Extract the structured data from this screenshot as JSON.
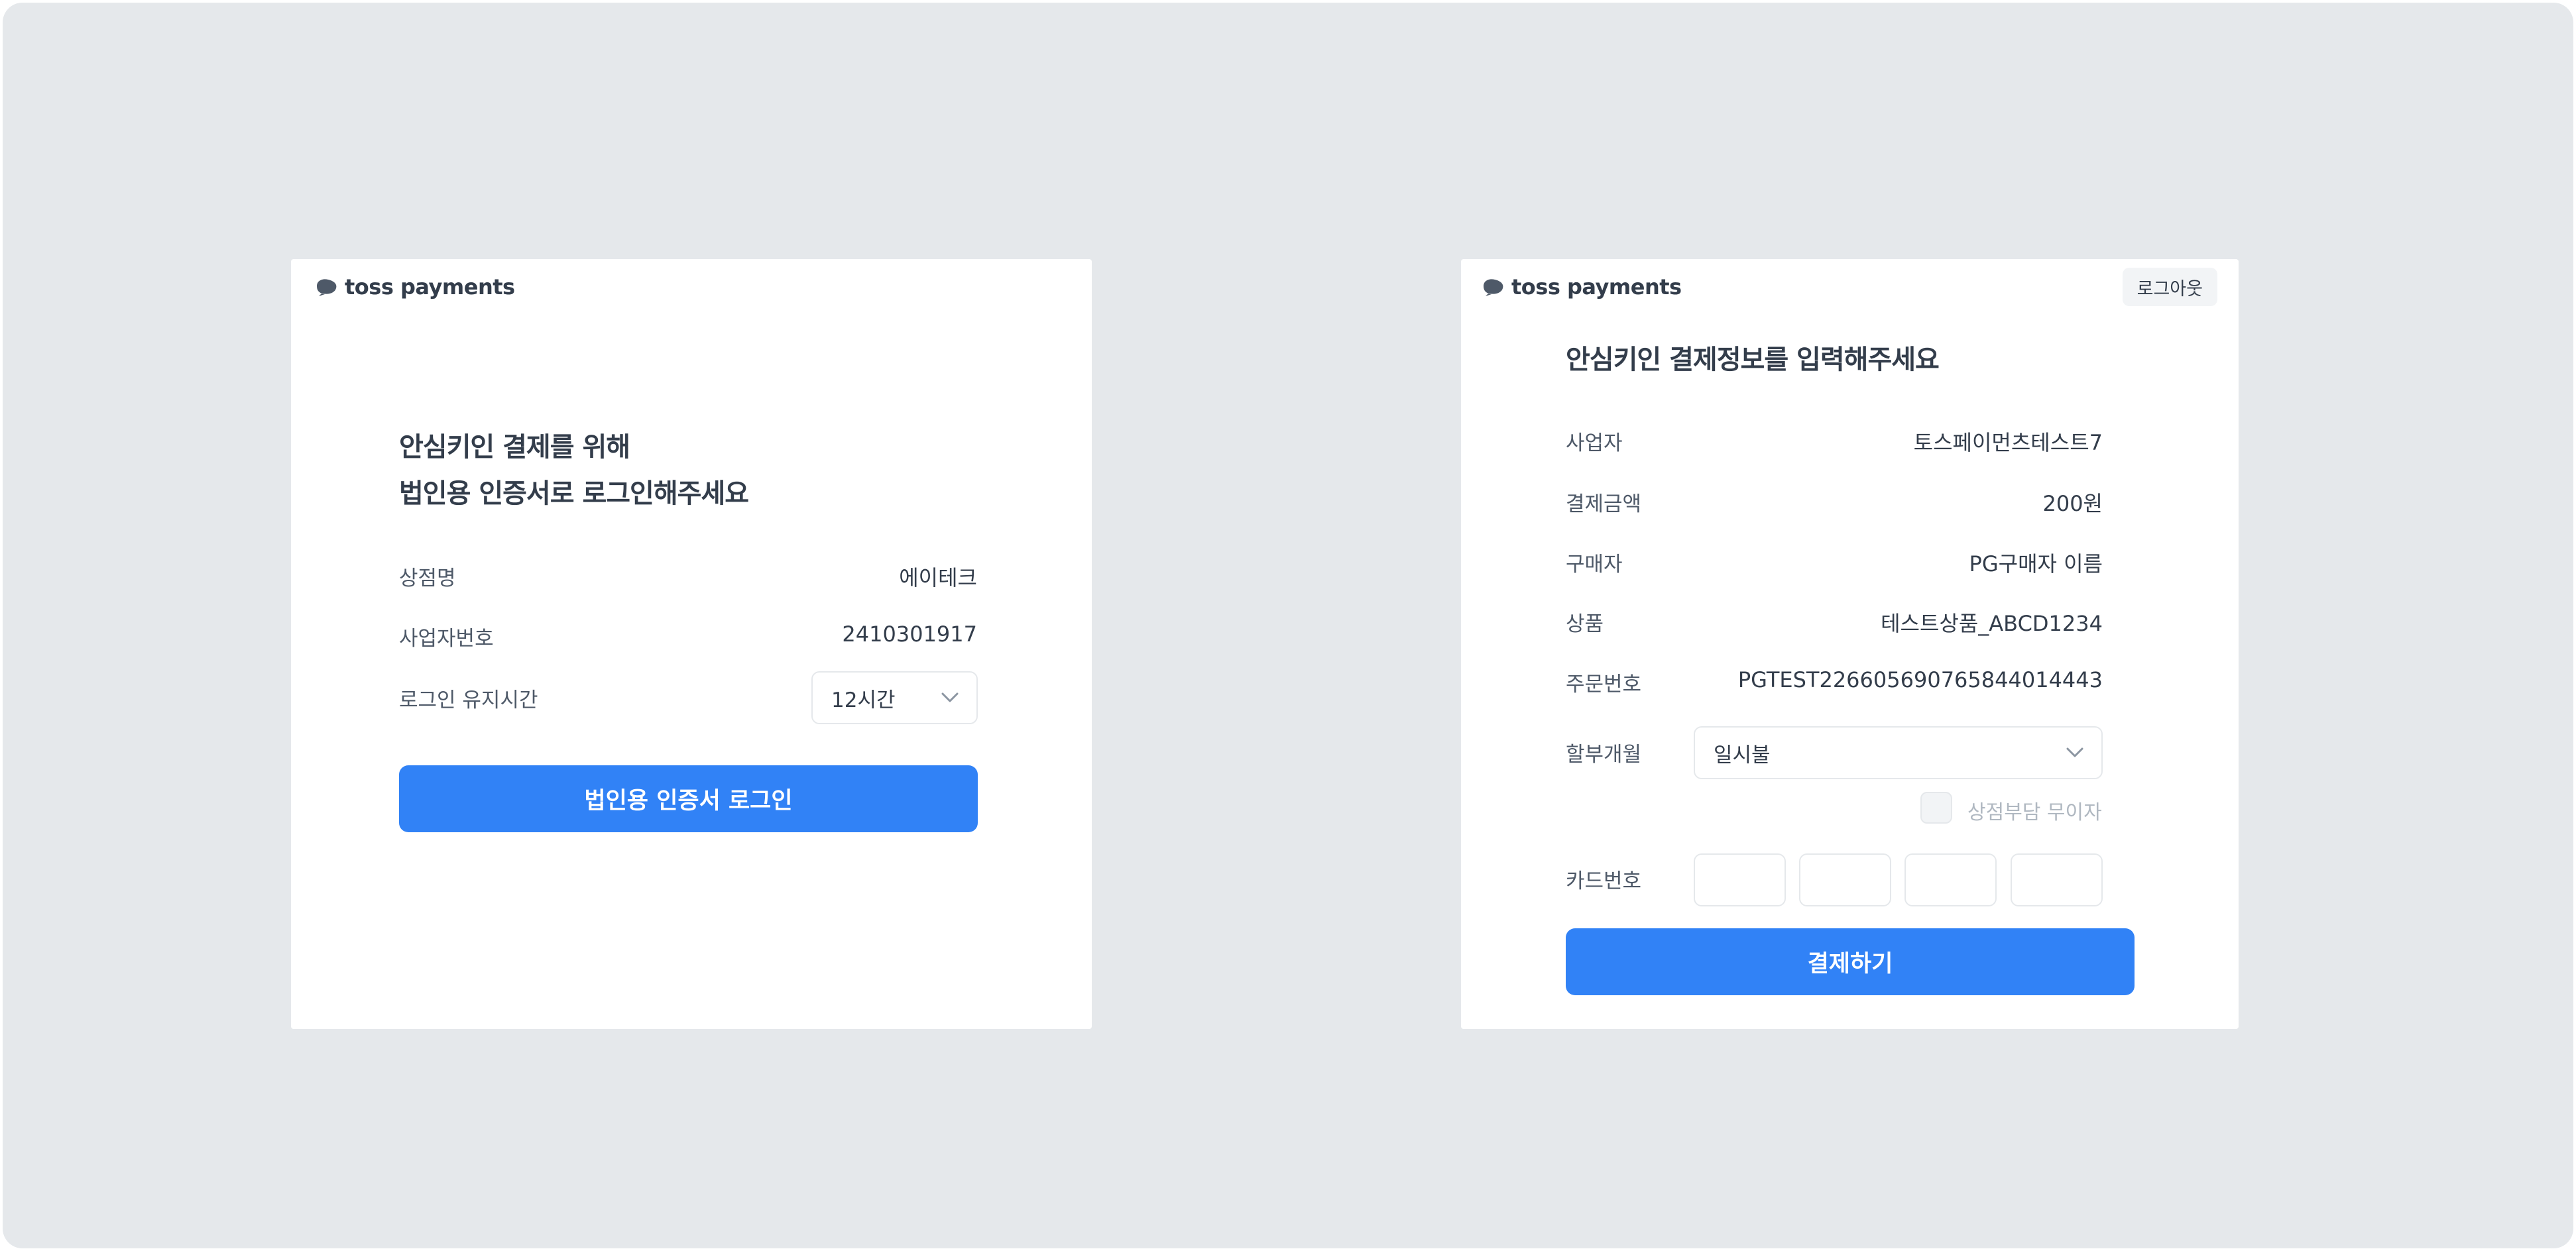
{
  "brand": {
    "logo_text": "toss payments"
  },
  "login_panel": {
    "title_line1": "안심키인 결제를 위해",
    "title_line2": "법인용 인증서로 로그인해주세요",
    "rows": [
      {
        "label": "상점명",
        "value": "에이테크"
      },
      {
        "label": "사업자번호",
        "value": "2410301917"
      }
    ],
    "keep_login": {
      "label": "로그인 유지시간",
      "selected": "12시간"
    },
    "login_button": "법인용 인증서 로그인"
  },
  "payment_panel": {
    "logout_button": "로그아웃",
    "title": "안심키인 결제정보를 입력해주세요",
    "rows": [
      {
        "label": "사업자",
        "value": "토스페이먼츠테스트7"
      },
      {
        "label": "결제금액",
        "value": "200원"
      },
      {
        "label": "구매자",
        "value": "PG구매자 이름"
      },
      {
        "label": "상품",
        "value": "테스트상품_ABCD1234"
      },
      {
        "label": "주문번호",
        "value": "PGTEST22660569076584401444​3"
      }
    ],
    "installment": {
      "label": "할부개월",
      "selected": "일시불"
    },
    "interest_free": {
      "label": "상점부담 무이자",
      "checked": false
    },
    "card_number": {
      "label": "카드번호",
      "segments": [
        "",
        "",
        "",
        ""
      ]
    },
    "pay_button": "결제하기"
  },
  "colors": {
    "background": "#e5e8eb",
    "panel": "#ffffff",
    "primary": "#3182f6",
    "text": "#333d4b",
    "muted": "#b0b8c1"
  }
}
